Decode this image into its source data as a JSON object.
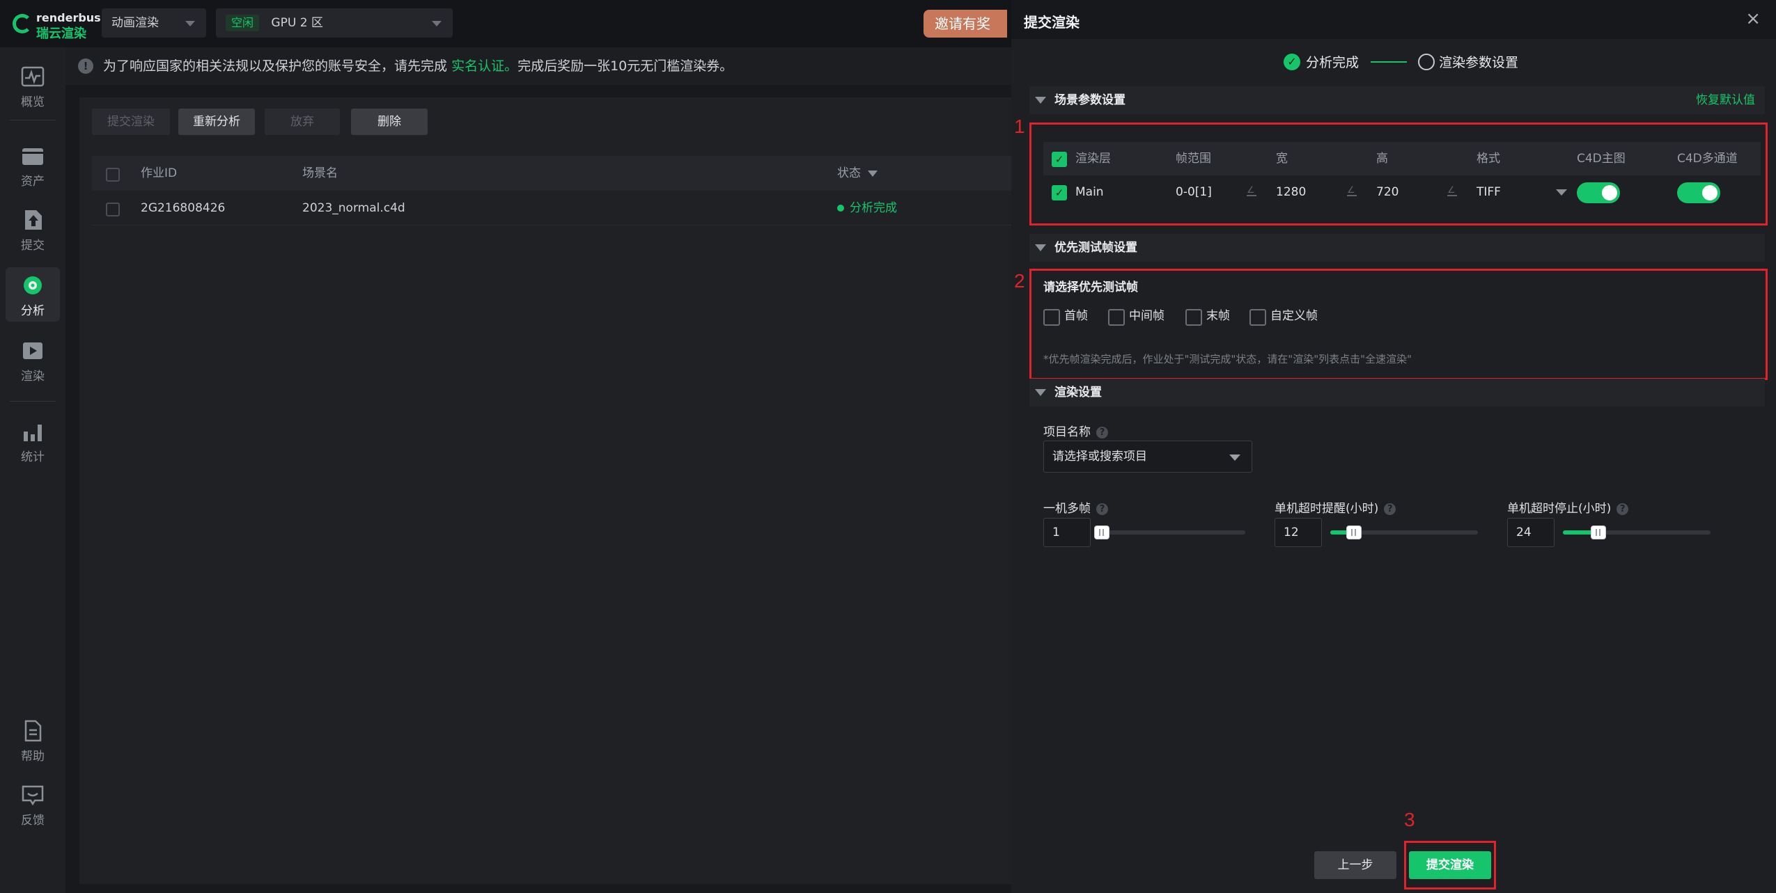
{
  "topbar": {
    "logo_en": "renderbus",
    "logo_cn": "瑞云渲染",
    "mode": "动画渲染",
    "gpu_badge": "空闲",
    "gpu_zone": "GPU 2 区",
    "invite": "邀请有奖"
  },
  "sidebar": {
    "items": [
      {
        "label": "概览",
        "icon": "pulse-icon"
      },
      {
        "label": "资产",
        "icon": "folder-icon"
      },
      {
        "label": "提交",
        "icon": "upload-icon"
      },
      {
        "label": "分析",
        "icon": "analysis-icon",
        "active": true
      },
      {
        "label": "渲染",
        "icon": "play-icon"
      },
      {
        "label": "统计",
        "icon": "bar-chart-icon"
      },
      {
        "label": "帮助",
        "icon": "document-icon"
      },
      {
        "label": "反馈",
        "icon": "feedback-icon"
      }
    ]
  },
  "notice": {
    "info_icon": "!",
    "prefix": "为了响应国家的相关法规以及保护您的账号安全，请先完成",
    "link": "实名认证。",
    "suffix": "完成后奖励一张10元无门槛渲染券。"
  },
  "toolbar": {
    "submit": "提交渲染",
    "reanalyze": "重新分析",
    "abandon": "放弃",
    "delete": "删除"
  },
  "job_table": {
    "headers": {
      "id": "作业ID",
      "scene": "场景名",
      "status": "状态"
    },
    "rows": [
      {
        "id": "2G216808426",
        "scene": "2023_normal.c4d",
        "status": "分析完成"
      }
    ]
  },
  "drawer": {
    "title": "提交渲染",
    "close": "×",
    "steps": {
      "step1": "分析完成",
      "step2": "渲染参数设置",
      "check": "✓"
    },
    "scene_section": {
      "title": "场景参数设置",
      "reset": "恢复默认值",
      "headers": {
        "layer": "渲染层",
        "frames": "帧范围",
        "width": "宽",
        "height": "高",
        "format": "格式",
        "c4d_main": "C4D主图",
        "c4d_multi": "C4D多通道"
      },
      "row": {
        "layer": "Main",
        "frames": "0-0[1]",
        "width": "1280",
        "height": "720",
        "format": "TIFF",
        "c4d_main": true,
        "c4d_multi": true
      }
    },
    "priority_section": {
      "title": "优先测试帧设置",
      "subtitle": "请选择优先测试帧",
      "options": [
        "首帧",
        "中间帧",
        "末帧",
        "自定义帧"
      ],
      "note": "*优先帧渲染完成后，作业处于\"测试完成\"状态，请在\"渲染\"列表点击\"全速渲染\""
    },
    "render_section": {
      "title": "渲染设置",
      "project_label": "项目名称",
      "project_placeholder": "请选择或搜索项目",
      "multi_frame_label": "一机多帧",
      "multi_frame_value": "1",
      "multi_frame_level": 0.03,
      "timeout_warn_label": "单机超时提醒(小时)",
      "timeout_warn_value": "12",
      "timeout_warn_level": 0.16,
      "timeout_stop_label": "单机超时停止(小时)",
      "timeout_stop_value": "24",
      "timeout_stop_level": 0.24,
      "help_icon": "?"
    },
    "footer": {
      "prev": "上一步",
      "submit": "提交渲染"
    }
  },
  "annotations": [
    "1",
    "2",
    "3"
  ],
  "colors": {
    "accent": "#16c56b",
    "annotation": "#e0232a"
  }
}
